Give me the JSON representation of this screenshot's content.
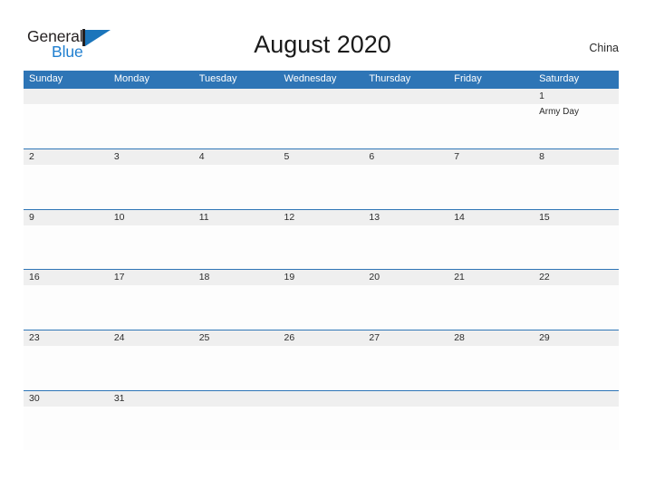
{
  "header": {
    "logo": {
      "word_one": "General",
      "word_two": "Blue",
      "mark": "sailboat-triangle"
    },
    "title": "August 2020",
    "country": "China"
  },
  "colors": {
    "header_blue": "#2e75b6",
    "logo_blue": "#1b75bb",
    "date_band_gray": "#efefef",
    "text_dark": "#2b2b2b",
    "page_background": "#ffffff"
  },
  "calendar": {
    "month": "August",
    "year": "2020",
    "weekday_headers": [
      "Sunday",
      "Monday",
      "Tuesday",
      "Wednesday",
      "Thursday",
      "Friday",
      "Saturday"
    ],
    "weeks": [
      {
        "days": [
          {
            "date": "",
            "event": ""
          },
          {
            "date": "",
            "event": ""
          },
          {
            "date": "",
            "event": ""
          },
          {
            "date": "",
            "event": ""
          },
          {
            "date": "",
            "event": ""
          },
          {
            "date": "",
            "event": ""
          },
          {
            "date": "1",
            "event": "Army Day"
          }
        ]
      },
      {
        "days": [
          {
            "date": "2",
            "event": ""
          },
          {
            "date": "3",
            "event": ""
          },
          {
            "date": "4",
            "event": ""
          },
          {
            "date": "5",
            "event": ""
          },
          {
            "date": "6",
            "event": ""
          },
          {
            "date": "7",
            "event": ""
          },
          {
            "date": "8",
            "event": ""
          }
        ]
      },
      {
        "days": [
          {
            "date": "9",
            "event": ""
          },
          {
            "date": "10",
            "event": ""
          },
          {
            "date": "11",
            "event": ""
          },
          {
            "date": "12",
            "event": ""
          },
          {
            "date": "13",
            "event": ""
          },
          {
            "date": "14",
            "event": ""
          },
          {
            "date": "15",
            "event": ""
          }
        ]
      },
      {
        "days": [
          {
            "date": "16",
            "event": ""
          },
          {
            "date": "17",
            "event": ""
          },
          {
            "date": "18",
            "event": ""
          },
          {
            "date": "19",
            "event": ""
          },
          {
            "date": "20",
            "event": ""
          },
          {
            "date": "21",
            "event": ""
          },
          {
            "date": "22",
            "event": ""
          }
        ]
      },
      {
        "days": [
          {
            "date": "23",
            "event": ""
          },
          {
            "date": "24",
            "event": ""
          },
          {
            "date": "25",
            "event": ""
          },
          {
            "date": "26",
            "event": ""
          },
          {
            "date": "27",
            "event": ""
          },
          {
            "date": "28",
            "event": ""
          },
          {
            "date": "29",
            "event": ""
          }
        ]
      },
      {
        "days": [
          {
            "date": "30",
            "event": ""
          },
          {
            "date": "31",
            "event": ""
          },
          {
            "date": "",
            "event": ""
          },
          {
            "date": "",
            "event": ""
          },
          {
            "date": "",
            "event": ""
          },
          {
            "date": "",
            "event": ""
          },
          {
            "date": "",
            "event": ""
          }
        ]
      }
    ]
  }
}
